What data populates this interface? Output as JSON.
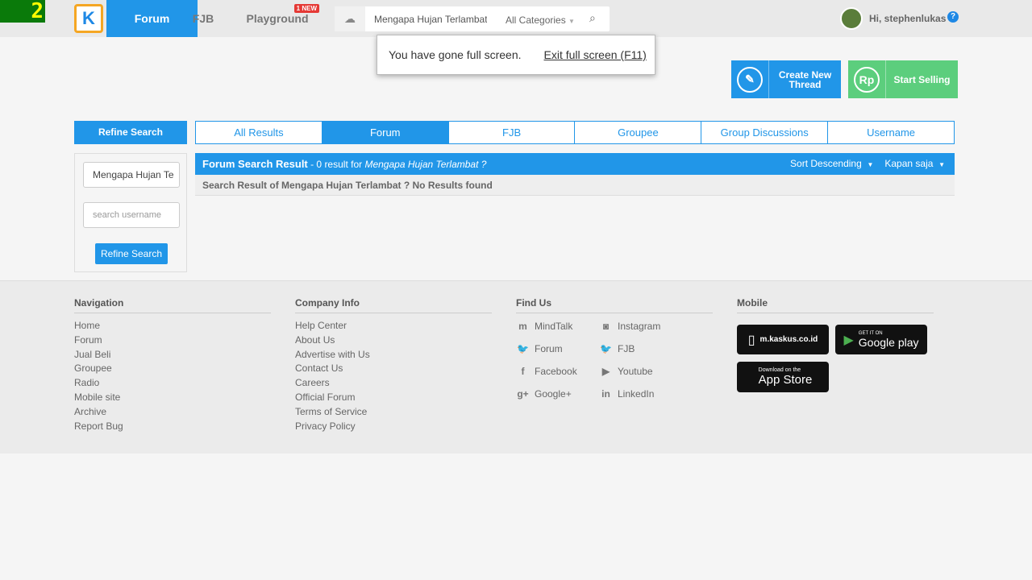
{
  "corner": {
    "text": "2"
  },
  "header": {
    "logo": "K",
    "nav": [
      {
        "label": "Forum"
      },
      {
        "label": "FJB"
      },
      {
        "label": "Playground",
        "badge": "1 NEW"
      }
    ],
    "search_value": "Mengapa Hujan Terlambat ?",
    "category": "All Categories",
    "user": "Hi, stephenlukas",
    "help": "?"
  },
  "fullscreen": {
    "message": "You have gone full screen.",
    "exit": "Exit full screen (F11)"
  },
  "actions": {
    "create": "Create New Thread",
    "sell": "Start Selling",
    "sell_icon": "Rp",
    "create_color": "#2196e8",
    "sell_color": "#5cce7d"
  },
  "refine": {
    "title": "Refine Search",
    "query": "Mengapa Hujan Te",
    "username_placeholder": "search username",
    "button": "Refine Search"
  },
  "tabs": [
    {
      "label": "All Results"
    },
    {
      "label": "Forum"
    },
    {
      "label": "FJB"
    },
    {
      "label": "Groupee"
    },
    {
      "label": "Group Discussions"
    },
    {
      "label": "Username"
    }
  ],
  "results": {
    "title": "Forum Search Result",
    "count_text": " - 0 result for ",
    "query": "Mengapa Hujan Terlambat ?",
    "sort": "Sort Descending",
    "time": "Kapan saja",
    "message": "Search Result of Mengapa Hujan Terlambat ? No Results found"
  },
  "footer": {
    "navigation": {
      "title": "Navigation",
      "links": [
        "Home",
        "Forum",
        "Jual Beli",
        "Groupee",
        "Radio",
        "Mobile site",
        "Archive",
        "Report Bug"
      ]
    },
    "company": {
      "title": "Company Info",
      "links": [
        "Help Center",
        "About Us",
        "Advertise with Us",
        "Contact Us",
        "Careers",
        "Official Forum",
        "Terms of Service",
        "Privacy Policy"
      ]
    },
    "find": {
      "title": "Find Us",
      "links": [
        {
          "label": "MindTalk",
          "icon": "m"
        },
        {
          "label": "Instagram",
          "icon": "◙"
        },
        {
          "label": "Forum",
          "icon": "🐦"
        },
        {
          "label": "FJB",
          "icon": "🐦"
        },
        {
          "label": "Facebook",
          "icon": "f"
        },
        {
          "label": "Youtube",
          "icon": "▶"
        },
        {
          "label": "Google+",
          "icon": "g+"
        },
        {
          "label": "LinkedIn",
          "icon": "in"
        }
      ]
    },
    "mobile": {
      "title": "Mobile",
      "site": "m.kaskus.co.id",
      "google_top": "GET IT ON",
      "google": "Google play",
      "apple_top": "Download on the",
      "apple": "App Store"
    }
  }
}
